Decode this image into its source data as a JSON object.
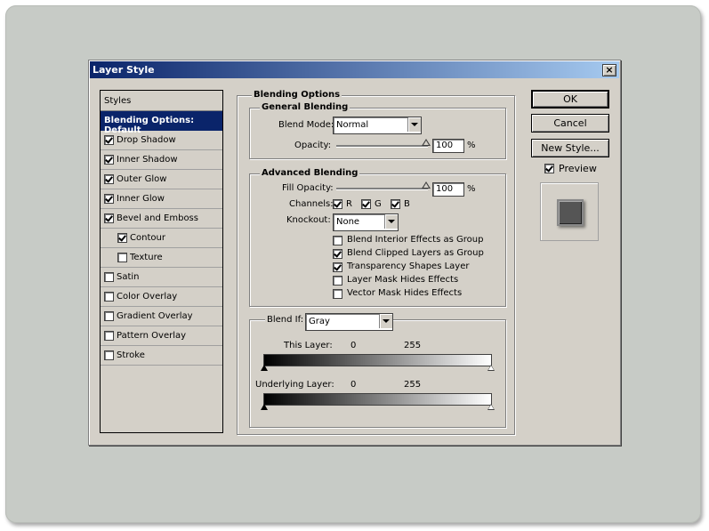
{
  "dialog": {
    "title": "Layer Style"
  },
  "left_panel": {
    "header": "Styles",
    "selected_item": "Blending Options: Default",
    "items": [
      {
        "label": "Drop Shadow",
        "checked": true
      },
      {
        "label": "Inner Shadow",
        "checked": true
      },
      {
        "label": "Outer Glow",
        "checked": true
      },
      {
        "label": "Inner Glow",
        "checked": true
      },
      {
        "label": "Bevel and Emboss",
        "checked": true
      },
      {
        "label": "Contour",
        "checked": true
      },
      {
        "label": "Texture",
        "checked": false
      },
      {
        "label": "Satin",
        "checked": false
      },
      {
        "label": "Color Overlay",
        "checked": false
      },
      {
        "label": "Gradient Overlay",
        "checked": false
      },
      {
        "label": "Pattern Overlay",
        "checked": false
      },
      {
        "label": "Stroke",
        "checked": false
      }
    ]
  },
  "blending_options": {
    "title": "Blending Options",
    "general": {
      "title": "General Blending",
      "blend_mode_label": "Blend Mode:",
      "blend_mode_value": "Normal",
      "opacity_label": "Opacity:",
      "opacity_value": "100",
      "opacity_unit": "%"
    },
    "advanced": {
      "title": "Advanced Blending",
      "fill_opacity_label": "Fill Opacity:",
      "fill_opacity_value": "100",
      "fill_opacity_unit": "%",
      "channels_label": "Channels:",
      "channels": [
        {
          "label": "R",
          "checked": true
        },
        {
          "label": "G",
          "checked": true
        },
        {
          "label": "B",
          "checked": true
        }
      ],
      "knockout_label": "Knockout:",
      "knockout_value": "None",
      "options": [
        {
          "label": "Blend Interior Effects as Group",
          "checked": false
        },
        {
          "label": "Blend Clipped Layers as Group",
          "checked": true
        },
        {
          "label": "Transparency Shapes Layer",
          "checked": true
        },
        {
          "label": "Layer Mask Hides Effects",
          "checked": false
        },
        {
          "label": "Vector Mask Hides Effects",
          "checked": false
        }
      ]
    },
    "blend_if": {
      "label": "Blend If:",
      "value": "Gray",
      "this_layer_label": "This Layer:",
      "this_layer_min": "0",
      "this_layer_max": "255",
      "underlying_label": "Underlying Layer:",
      "underlying_min": "0",
      "underlying_max": "255"
    }
  },
  "buttons": {
    "ok": "OK",
    "cancel": "Cancel",
    "new_style": "New Style..."
  },
  "preview": {
    "label": "Preview",
    "checked": true
  },
  "colors": {
    "title_start": "#0a246a",
    "title_end": "#a6caf0",
    "dialog_bg": "#d4d0c8",
    "frame_bg": "#c7cbc6"
  }
}
